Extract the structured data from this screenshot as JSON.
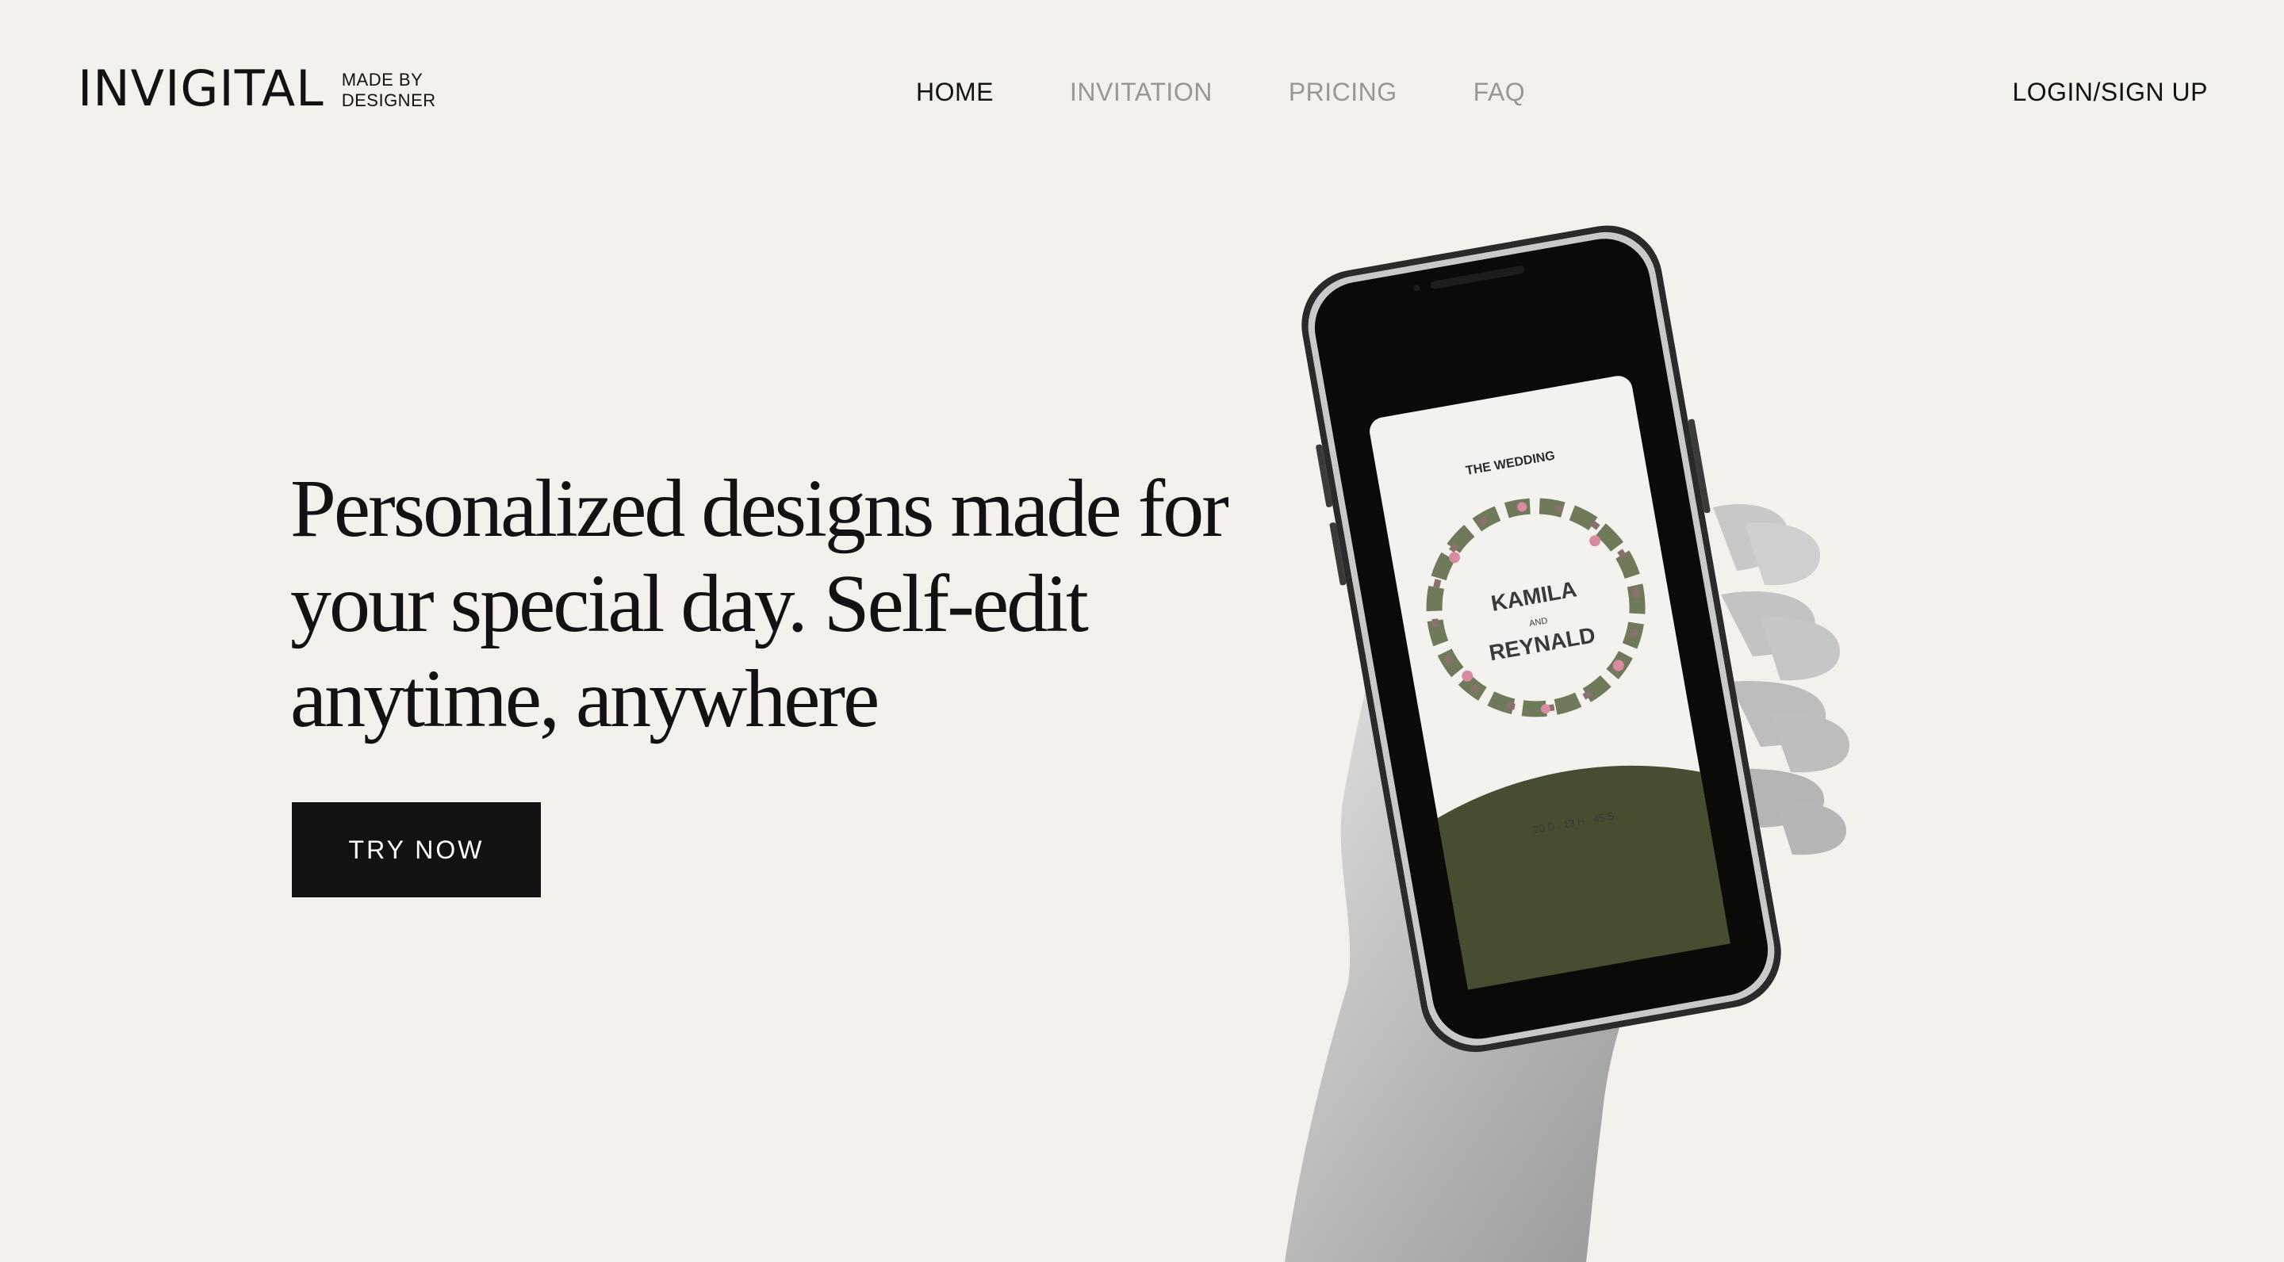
{
  "header": {
    "logo_word": "INVIGITAL",
    "logo_tag_line1": "MADE BY",
    "logo_tag_line2": "DESIGNER",
    "nav": [
      {
        "label": "HOME",
        "active": true
      },
      {
        "label": "INVITATION",
        "active": false
      },
      {
        "label": "PRICING",
        "active": false
      },
      {
        "label": "FAQ",
        "active": false
      }
    ],
    "login_label": "LOGIN/SIGN UP"
  },
  "hero": {
    "title_line1": "Personalized designs made for",
    "title_line2": "your special day. Self-edit",
    "title_line3": "anytime, anywhere",
    "cta_label": "TRY NOW"
  },
  "invitation_card": {
    "heading": "THE WEDDING",
    "name1": "KAMILA",
    "conjunction": "AND",
    "name2": "REYNALD",
    "countdown": "20 D . 13 H . 45 S"
  },
  "colors": {
    "background": "#f4f0ec",
    "text": "#121212",
    "nav_inactive": "#9a9692",
    "card_green": "#464d31",
    "phone_body": "#0b0a08"
  }
}
